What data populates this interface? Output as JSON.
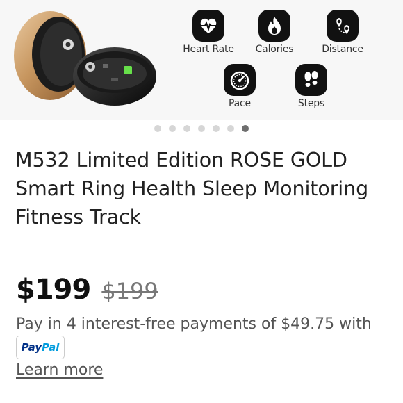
{
  "hero": {
    "features": [
      {
        "label": "Heart Rate",
        "icon": "heart-rate-icon"
      },
      {
        "label": "Calories",
        "icon": "flame-icon"
      },
      {
        "label": "Distance",
        "icon": "map-pin-icon"
      },
      {
        "label": "Pace",
        "icon": "speedometer-icon"
      },
      {
        "label": "Steps",
        "icon": "footprints-icon"
      }
    ]
  },
  "carousel": {
    "total": 7,
    "active_index": 6
  },
  "product": {
    "title": "M532 Limited Edition ROSE GOLD Smart Ring Health Sleep Monitoring Fitness Track",
    "price": "$199",
    "original_price": "$199"
  },
  "payment": {
    "installments_text": "Pay in 4 interest-free payments of $49.75 with",
    "paypal_part1": "Pay",
    "paypal_part2": "Pal",
    "learn_more": "Learn more"
  },
  "colors": {
    "icon_bg": "#111111",
    "dot_active": "#6e6e6e",
    "dot_inactive": "#d6d6d6",
    "paypal_dark": "#003087",
    "paypal_light": "#009cde"
  }
}
